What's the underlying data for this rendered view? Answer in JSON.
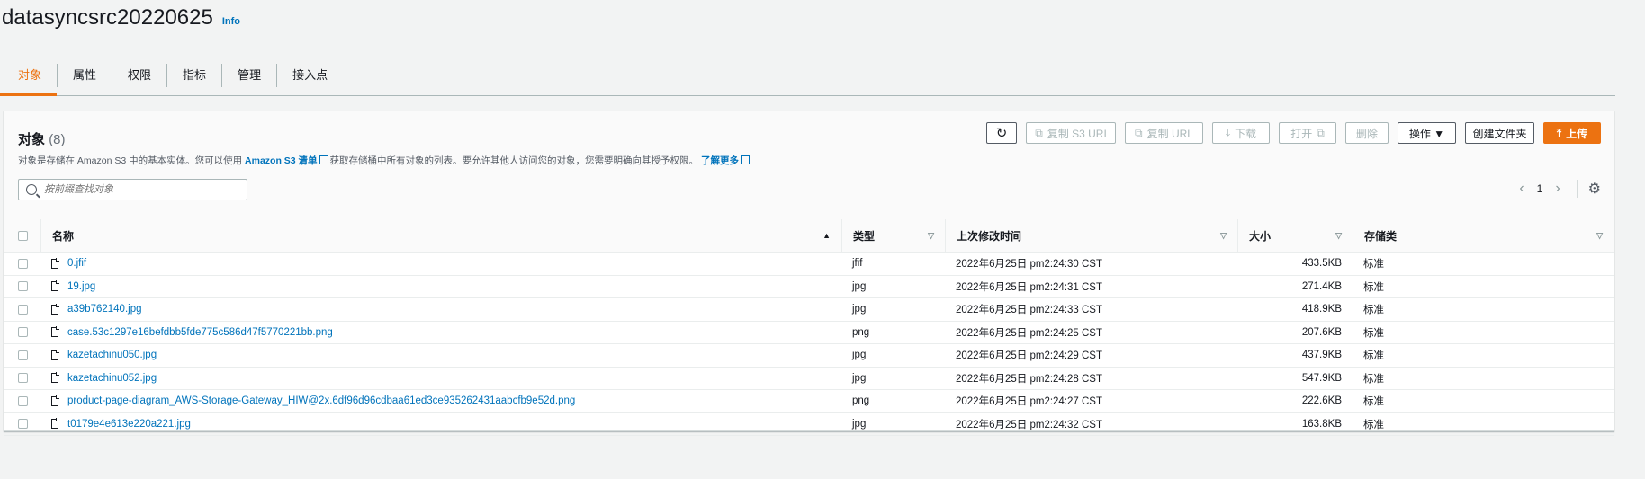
{
  "header": {
    "bucket_name": "datasyncsrc20220625",
    "info_label": "Info"
  },
  "tabs": [
    {
      "label": "对象",
      "active": true
    },
    {
      "label": "属性"
    },
    {
      "label": "权限"
    },
    {
      "label": "指标"
    },
    {
      "label": "管理"
    },
    {
      "label": "接入点"
    }
  ],
  "objects_panel": {
    "title": "对象",
    "count": "(8)",
    "description_pre": "对象是存储在 Amazon S3 中的基本实体。您可以使用 ",
    "description_link": "Amazon S3 清单",
    "description_mid": "获取存储桶中所有对象的列表。要允许其他人访问您的对象，您需要明确向其授予权限。",
    "learn_more": "了解更多",
    "buttons": {
      "refresh_icon": "refresh-icon",
      "copy_s3_uri": "复制 S3 URI",
      "copy_url": "复制 URL",
      "download": "下载",
      "open": "打开",
      "delete": "删除",
      "actions": "操作 ▼",
      "create_folder": "创建文件夹",
      "upload": "上传"
    },
    "search_placeholder": "按前缀查找对象",
    "pager": {
      "page": "1"
    }
  },
  "table": {
    "columns": [
      "名称",
      "类型",
      "上次修改时间",
      "大小",
      "存储类"
    ],
    "rows": [
      {
        "name": "0.jfif",
        "type": "jfif",
        "modified": "2022年6月25日 pm2:24:30 CST",
        "size": "433.5KB",
        "storage": "标准"
      },
      {
        "name": "19.jpg",
        "type": "jpg",
        "modified": "2022年6月25日 pm2:24:31 CST",
        "size": "271.4KB",
        "storage": "标准"
      },
      {
        "name": "a39b762140.jpg",
        "type": "jpg",
        "modified": "2022年6月25日 pm2:24:33 CST",
        "size": "418.9KB",
        "storage": "标准"
      },
      {
        "name": "case.53c1297e16befdbb5fde775c586d47f5770221bb.png",
        "type": "png",
        "modified": "2022年6月25日 pm2:24:25 CST",
        "size": "207.6KB",
        "storage": "标准"
      },
      {
        "name": "kazetachinu050.jpg",
        "type": "jpg",
        "modified": "2022年6月25日 pm2:24:29 CST",
        "size": "437.9KB",
        "storage": "标准"
      },
      {
        "name": "kazetachinu052.jpg",
        "type": "jpg",
        "modified": "2022年6月25日 pm2:24:28 CST",
        "size": "547.9KB",
        "storage": "标准"
      },
      {
        "name": "product-page-diagram_AWS-Storage-Gateway_HIW@2x.6df96d96cdbaa61ed3ce935262431aabcfb9e52d.png",
        "type": "png",
        "modified": "2022年6月25日 pm2:24:27 CST",
        "size": "222.6KB",
        "storage": "标准"
      },
      {
        "name": "t0179e4e613e220a221.jpg",
        "type": "jpg",
        "modified": "2022年6月25日 pm2:24:32 CST",
        "size": "163.8KB",
        "storage": "标准"
      }
    ]
  },
  "colors": {
    "accent": "#ec7211",
    "link": "#0073bb"
  }
}
